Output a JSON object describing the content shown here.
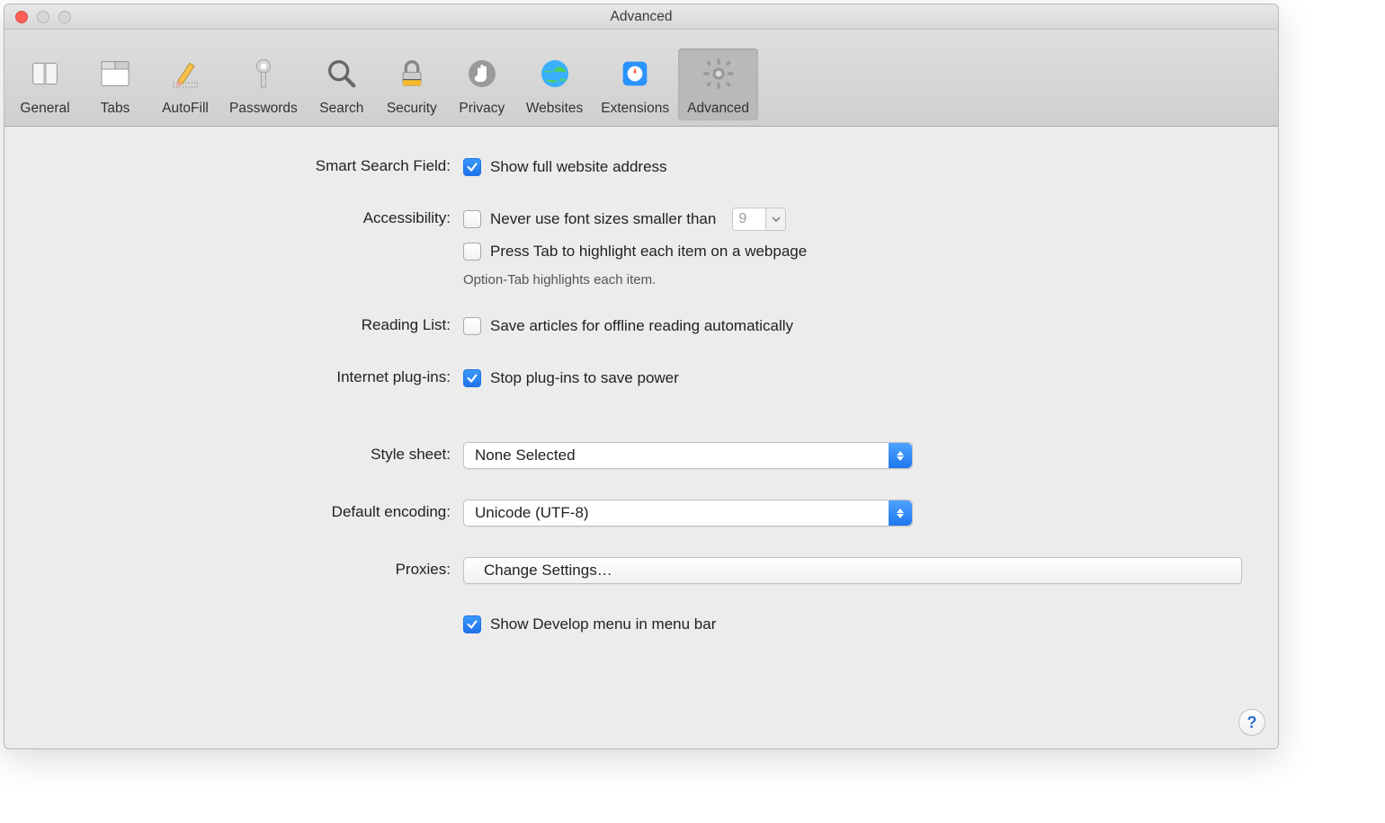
{
  "window": {
    "title": "Advanced"
  },
  "toolbar": {
    "items": [
      {
        "label": "General"
      },
      {
        "label": "Tabs"
      },
      {
        "label": "AutoFill"
      },
      {
        "label": "Passwords"
      },
      {
        "label": "Search"
      },
      {
        "label": "Security"
      },
      {
        "label": "Privacy"
      },
      {
        "label": "Websites"
      },
      {
        "label": "Extensions"
      },
      {
        "label": "Advanced"
      }
    ]
  },
  "sections": {
    "smart_search": {
      "label": "Smart Search Field:",
      "show_full_address": {
        "label": "Show full website address",
        "checked": true
      }
    },
    "accessibility": {
      "label": "Accessibility:",
      "min_font": {
        "label": "Never use font sizes smaller than",
        "checked": false,
        "value": "9"
      },
      "press_tab": {
        "label": "Press Tab to highlight each item on a webpage",
        "checked": false
      },
      "hint": "Option-Tab highlights each item."
    },
    "reading_list": {
      "label": "Reading List:",
      "offline": {
        "label": "Save articles for offline reading automatically",
        "checked": false
      }
    },
    "plugins": {
      "label": "Internet plug-ins:",
      "stop": {
        "label": "Stop plug-ins to save power",
        "checked": true
      }
    },
    "style_sheet": {
      "label": "Style sheet:",
      "value": "None Selected"
    },
    "encoding": {
      "label": "Default encoding:",
      "value": "Unicode (UTF-8)"
    },
    "proxies": {
      "label": "Proxies:",
      "button": "Change Settings…"
    },
    "develop": {
      "label": "Show Develop menu in menu bar",
      "checked": true
    }
  },
  "help": "?"
}
